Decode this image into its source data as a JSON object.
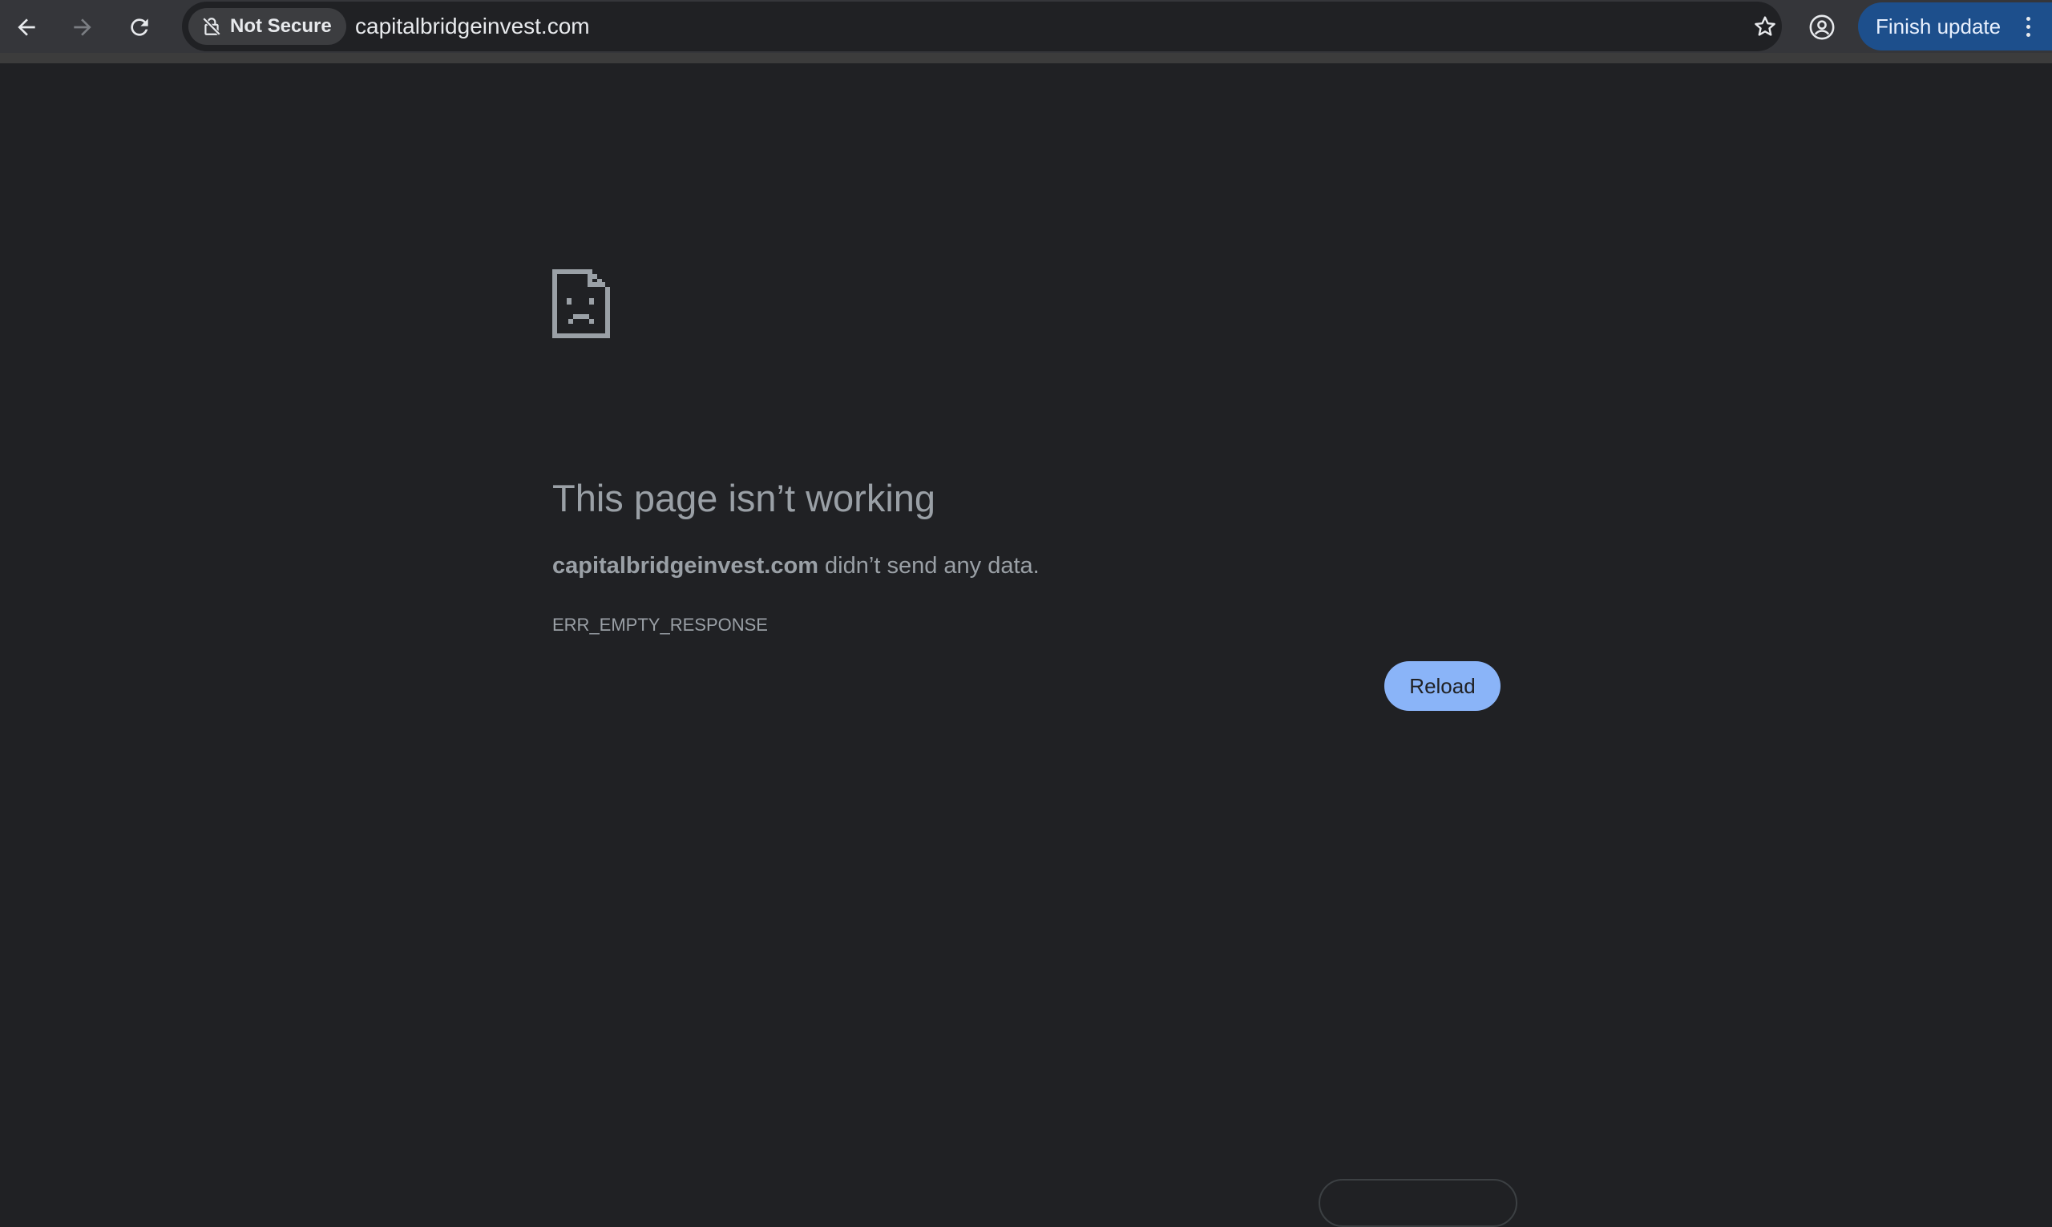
{
  "browser": {
    "security_label": "Not Secure",
    "url": "capitalbridgeinvest.com",
    "update_button_label": "Finish update"
  },
  "error_page": {
    "heading": "This page isn’t working",
    "host": "capitalbridgeinvest.com",
    "message_suffix": " didn’t send any data.",
    "error_code": "ERR_EMPTY_RESPONSE",
    "reload_label": "Reload"
  },
  "icons": {
    "back": "back-arrow-icon",
    "forward": "forward-arrow-icon",
    "reload": "reload-icon",
    "not_secure": "not-secure-lock-icon",
    "bookmark": "star-icon",
    "profile": "profile-icon",
    "menu": "kebab-menu-icon",
    "error": "sad-document-icon"
  },
  "colors": {
    "background": "#202124",
    "toolbar": "#35363a",
    "text_muted": "#9aa0a6",
    "reload_button": "#8ab4f8",
    "update_button": "#1d4f8c"
  }
}
